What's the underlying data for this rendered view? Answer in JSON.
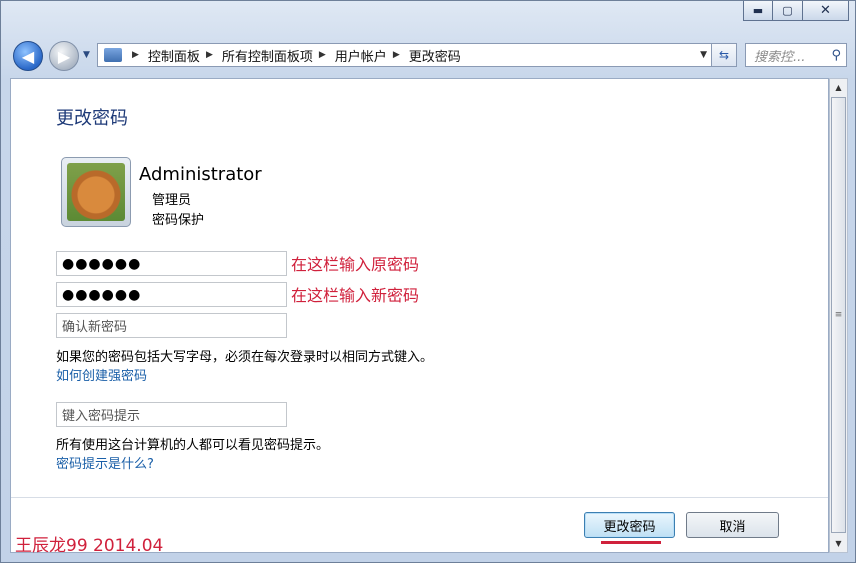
{
  "window": {
    "controls": {
      "minimize": "▬",
      "maximize": "▢",
      "close": "✕"
    }
  },
  "nav": {
    "breadcrumbs": [
      "控制面板",
      "所有控制面板项",
      "用户帐户",
      "更改密码"
    ],
    "search_placeholder": "搜索控...",
    "icons": {
      "back": "back-arrow-icon",
      "forward": "forward-arrow-icon",
      "refresh": "refresh-icon",
      "search": "search-icon"
    }
  },
  "page": {
    "title": "更改密码",
    "user": {
      "name": "Administrator",
      "role": "管理员",
      "status": "密码保护"
    },
    "fields": {
      "current_password_value": "●●●●●●",
      "new_password_value": "●●●●●●",
      "confirm_placeholder": "确认新密码",
      "hint_placeholder": "键入密码提示"
    },
    "annotations": {
      "current_hint": "在这栏输入原密码",
      "new_hint": "在这栏输入新密码"
    },
    "case_note": "如果您的密码包括大写字母，必须在每次登录时以相同方式键入。",
    "strong_password_link": "如何创建强密码",
    "hint_note": "所有使用这台计算机的人都可以看见密码提示。",
    "hint_link": "密码提示是什么?",
    "buttons": {
      "change": "更改密码",
      "cancel": "取消"
    }
  },
  "signature": "王辰龙99 2014.04",
  "colors": {
    "annotation_red": "#d0213c",
    "link_blue": "#1a5fa8",
    "title_blue": "#1e3a78"
  }
}
